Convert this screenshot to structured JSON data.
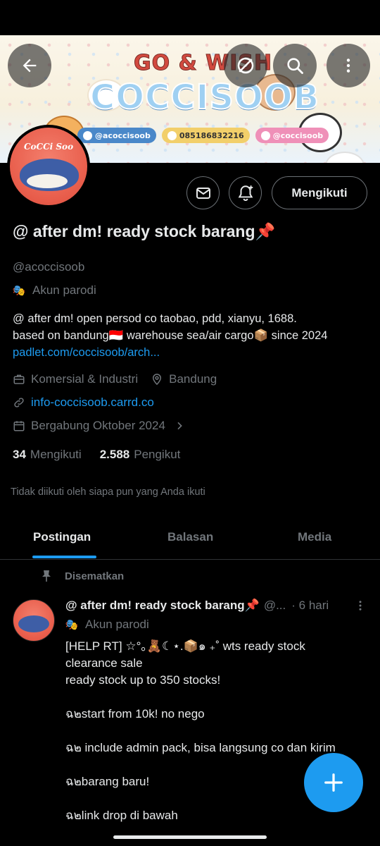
{
  "banner": {
    "tagline": "GO & WISH",
    "brand": "COCCISOOB",
    "socials": [
      "@acoccisoob",
      "085186832216",
      "@coccisoob"
    ]
  },
  "avatar_text": "CoCCi Soo",
  "actions": {
    "follow_label": "Mengikuti"
  },
  "profile": {
    "display_name": "@ after dm! ready stock barang📌",
    "handle": "@acoccisoob",
    "parody_label": "Akun parodi",
    "bio_line1": "@ after dm! open persod co taobao, pdd, xianyu, 1688.",
    "bio_line2": "based on bandung🇮🇩 warehouse sea/air cargo📦 since 2024",
    "bio_link": "padlet.com/coccisoob/arch...",
    "category": "Komersial & Industri",
    "location": "Bandung",
    "website": "info-coccisoob.carrd.co",
    "joined": "Bergabung Oktober 2024",
    "following_count": "34",
    "following_label": "Mengikuti",
    "followers_count": "2.588",
    "followers_label": "Pengikut",
    "not_followed_text": "Tidak diikuti oleh siapa pun yang Anda ikuti"
  },
  "tabs": [
    "Postingan",
    "Balasan",
    "Media"
  ],
  "post": {
    "pinned_label": "Disematkan",
    "author_name": "@ after dm! ready stock barang📌",
    "author_handle": "@...",
    "time": "· 6 hari",
    "parody_label": "Akun parodi",
    "lines": [
      "[HELP RT] ☆°｡🧸☾⋆.📦๑ ₊˚ wts ready stock",
      "clearance sale",
      "ready stock up to 350 stocks!",
      "",
      "ฉ๒start from 10k! no nego",
      "",
      "ฉ๒ include admin pack, bisa langsung co dan kirim",
      "",
      "ฉ๒barang baru!",
      "",
      "ฉ๒link drop di bawah"
    ]
  },
  "colors": {
    "background": "#000000",
    "text_primary": "#e7e9ea",
    "text_secondary": "#71767b",
    "accent": "#1d9bf0"
  }
}
